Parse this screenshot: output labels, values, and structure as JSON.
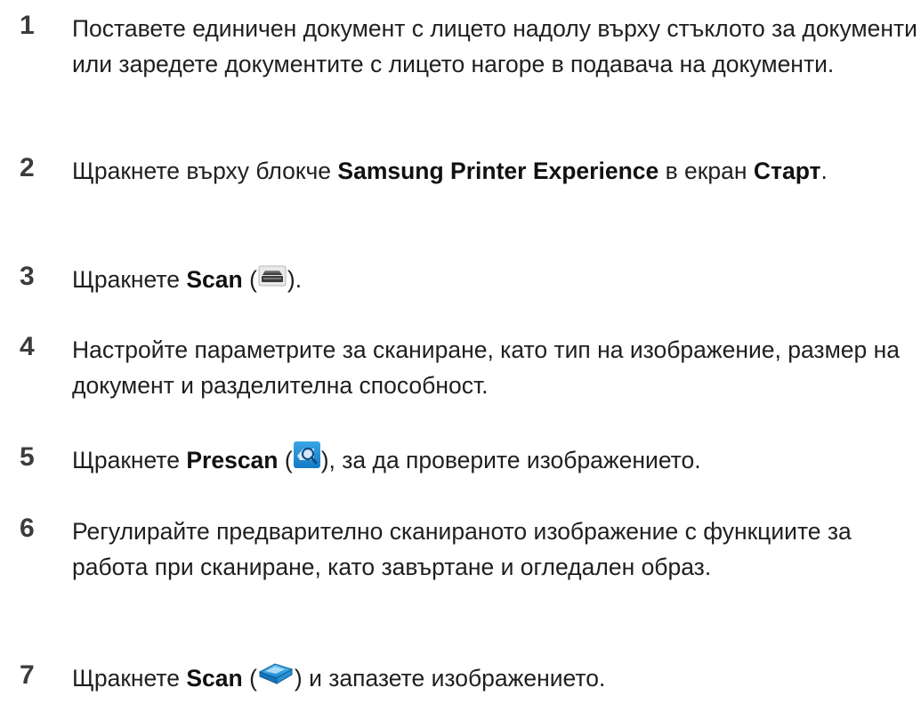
{
  "steps": [
    {
      "number": "1",
      "text": "Поставете единичен документ с лицето надолу върху стъклото за документи или заредете документите с лицето нагоре в подавача на документи."
    },
    {
      "number": "2",
      "pre": "Щракнете върху блокче ",
      "bold1": "Samsung Printer Experience",
      "mid": " в екран ",
      "bold2": "Старт",
      "post": "."
    },
    {
      "number": "3",
      "pre": "Щракнете ",
      "bold": "Scan",
      "open": " (",
      "icon": "scanner-icon",
      "close": ")."
    },
    {
      "number": "4",
      "text": "Настройте параметрите за сканиране, като тип на изображение, размер на документ и разделителна способност."
    },
    {
      "number": "5",
      "pre": "Щракнете ",
      "bold": "Prescan",
      "open": " (",
      "icon": "prescan-magnifier-icon",
      "close": "), за да проверите изображението."
    },
    {
      "number": "6",
      "text": "Регулирайте предварително сканираното изображение с функциите за работа при сканиране, като завъртане и огледален образ."
    },
    {
      "number": "7",
      "pre": "Щракнете ",
      "bold": "Scan",
      "open": " (",
      "icon": "scan-blue-scanner-icon",
      "close": ") и запазете изображението."
    }
  ],
  "colors": {
    "text": "#1f1f1f",
    "number": "#3c3c3c",
    "icon_blue": "#1e8fd6"
  }
}
